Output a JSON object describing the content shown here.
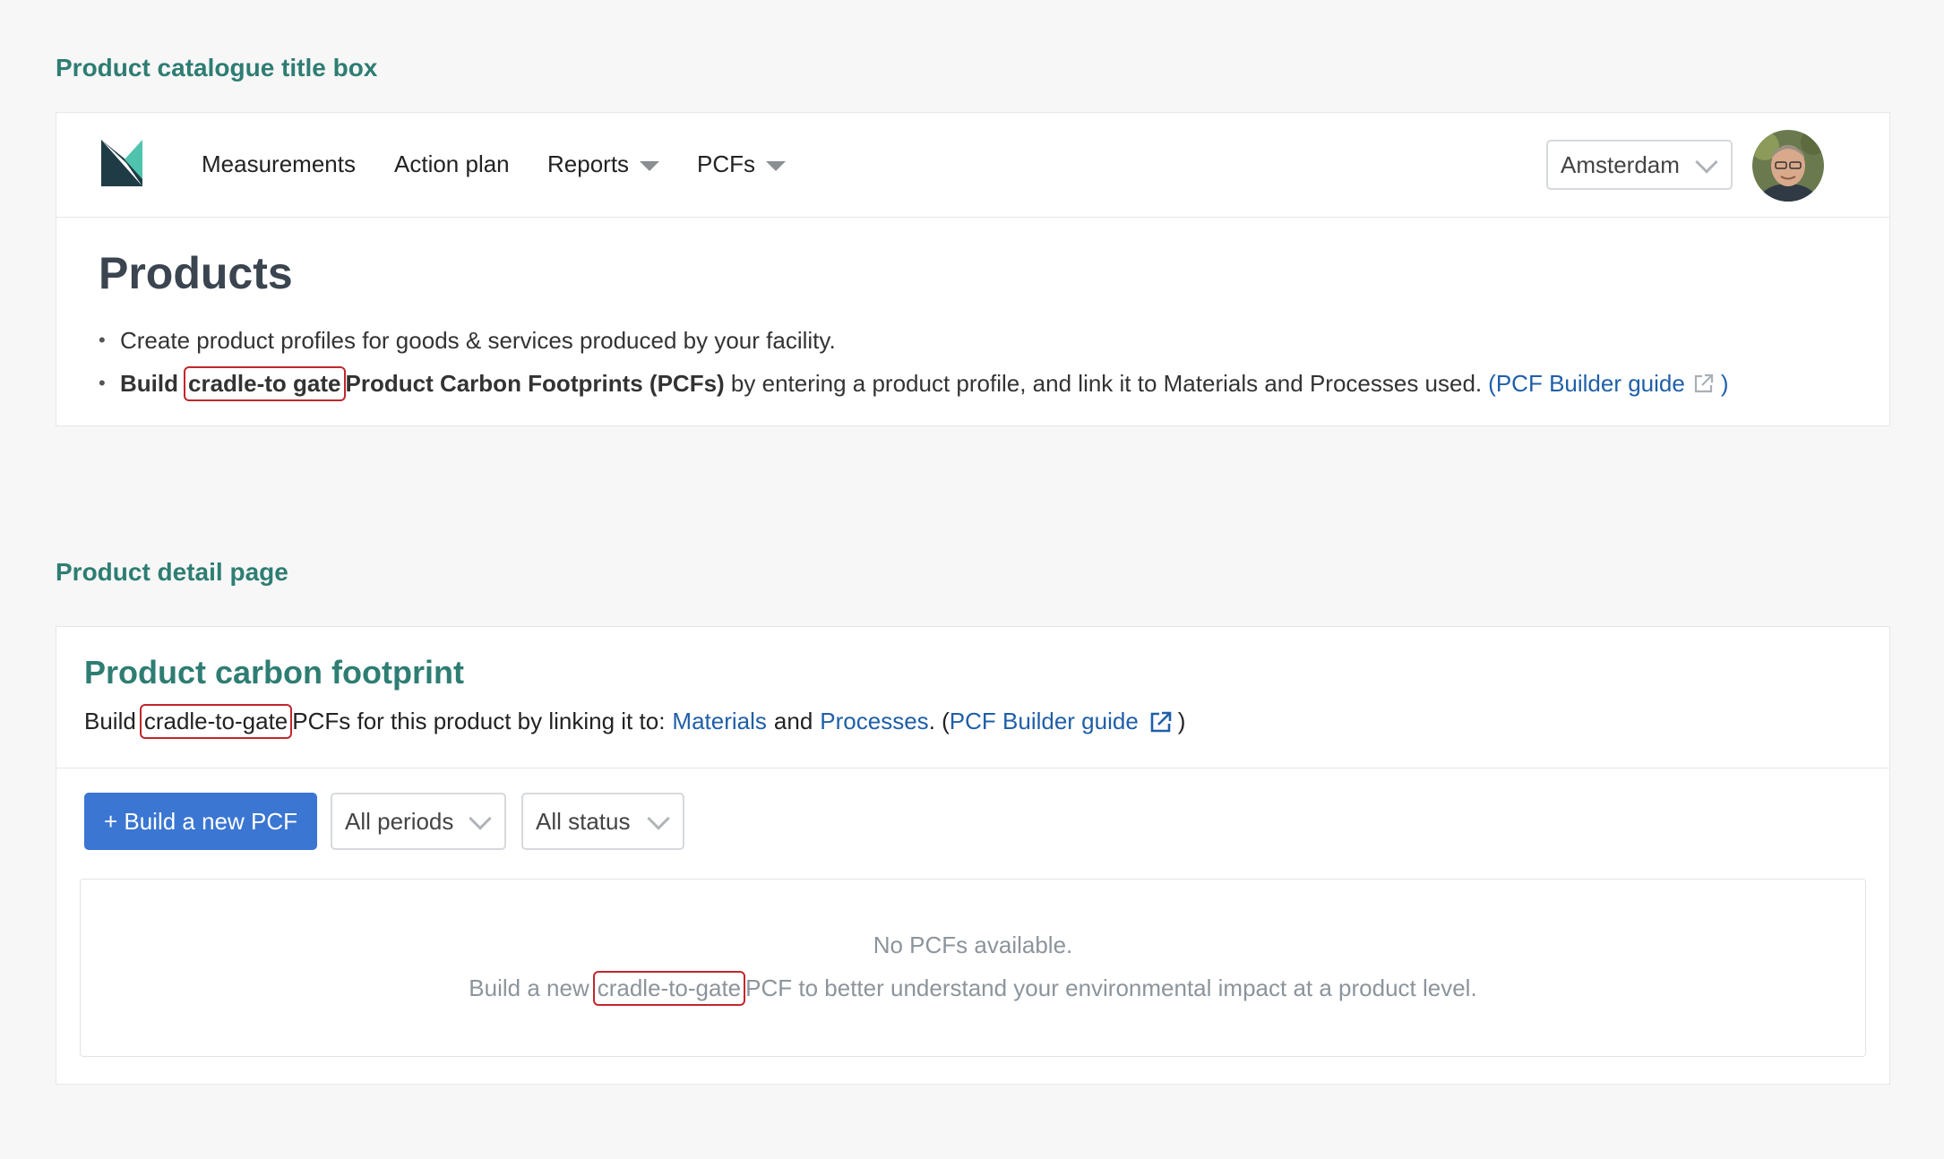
{
  "section_labels": {
    "title_box": "Product catalogue title box",
    "detail_page": "Product detail page"
  },
  "nav": {
    "items": [
      {
        "label": "Measurements",
        "has_dropdown": false
      },
      {
        "label": "Action plan",
        "has_dropdown": false
      },
      {
        "label": "Reports",
        "has_dropdown": true
      },
      {
        "label": "PCFs",
        "has_dropdown": true
      }
    ],
    "location_select": "Amsterdam"
  },
  "products": {
    "title": "Products",
    "bullet1": "Create product profiles for goods & services produced by your facility.",
    "bullet2": {
      "build": "Build",
      "highlight": "cradle-to gate",
      "bold_rest": "Product Carbon Footprints (PCFs)",
      "rest": " by entering a product profile, and link it to Materials and Processes used.",
      "guide_open": "(",
      "guide_link": "PCF Builder guide",
      "guide_close": ")"
    }
  },
  "pcf": {
    "title": "Product carbon footprint",
    "desc_build": "Build",
    "desc_highlight": "cradle-to-gate",
    "desc_mid": "PCFs for this product by linking it to:",
    "materials_link": "Materials",
    "and": "and",
    "processes_link": "Processes",
    "desc_end": ". (",
    "guide_link": "PCF Builder guide",
    "guide_close": ")",
    "build_button": "+ Build a new PCF",
    "period_select": "All periods",
    "status_select": "All status",
    "empty_title": "No PCFs available.",
    "empty_pre": "Build a new",
    "empty_highlight": "cradle-to-gate",
    "empty_post": "PCF to better understand your environmental impact at a product level."
  },
  "colors": {
    "accent_green": "#2e7d73",
    "link_blue": "#1f5fa8",
    "primary_button": "#3a76d2",
    "highlight_border": "#c0272d"
  }
}
